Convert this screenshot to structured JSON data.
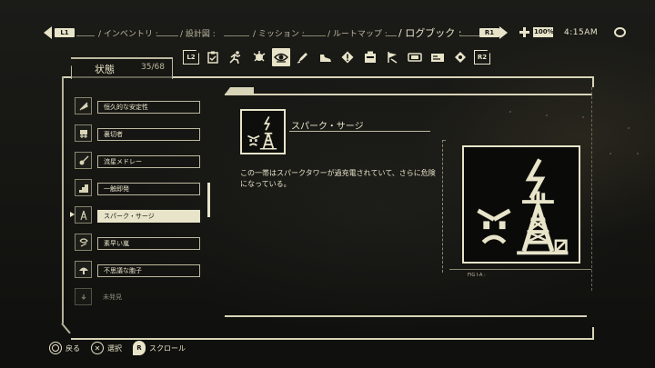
{
  "topbar": {
    "left_button": "L1",
    "right_button": "R1",
    "tabs": [
      {
        "label": "/ インベントリ :"
      },
      {
        "label": "/ 設計図 :"
      },
      {
        "label": "/ ミッション :"
      },
      {
        "label": "/ ルートマップ :"
      },
      {
        "label": "/ ログブック :"
      }
    ],
    "battery": "100%",
    "time": "4:15AM"
  },
  "icon_strip": {
    "left_button": "L2",
    "right_button": "R2",
    "icons": [
      "feather-icon",
      "clipboard-icon",
      "runner-icon",
      "trophy-icon",
      "eye-icon",
      "pen-icon",
      "shoe-icon",
      "warning-sign-icon",
      "machine-icon",
      "flag-icon",
      "key-icon",
      "tape-icon",
      "map-icon",
      "gem-icon"
    ],
    "active_index": 4
  },
  "category": {
    "title": "状態",
    "count": "35/68"
  },
  "list": {
    "items": [
      {
        "label": "恒久的な安定性",
        "icon": "feather-icon"
      },
      {
        "label": "裏切者",
        "icon": "figure-icon"
      },
      {
        "label": "流星メドレー",
        "icon": "guitar-icon"
      },
      {
        "label": "一触即発",
        "icon": "stairs-icon"
      },
      {
        "label": "スパーク・サージ",
        "icon": "spark-tower-icon"
      },
      {
        "label": "素早い嵐",
        "icon": "storm-icon"
      },
      {
        "label": "不思議な胞子",
        "icon": "mushroom-icon"
      },
      {
        "label": "未発見",
        "icon": "locked-icon"
      }
    ],
    "selected_index": 4
  },
  "detail": {
    "title": "スパーク・サージ",
    "description": "この一帯はスパークタワーが過充電されていて、さらに危険になっている。",
    "figure_caption": "FIG I-A :",
    "figure_icon": "angry-face-spark-tower-icon"
  },
  "footer": {
    "back": "戻る",
    "select": "選択",
    "scroll": "スクロール",
    "scroll_button": "R"
  },
  "colors": {
    "accent": "#e8e4c9",
    "background": "#141411"
  }
}
